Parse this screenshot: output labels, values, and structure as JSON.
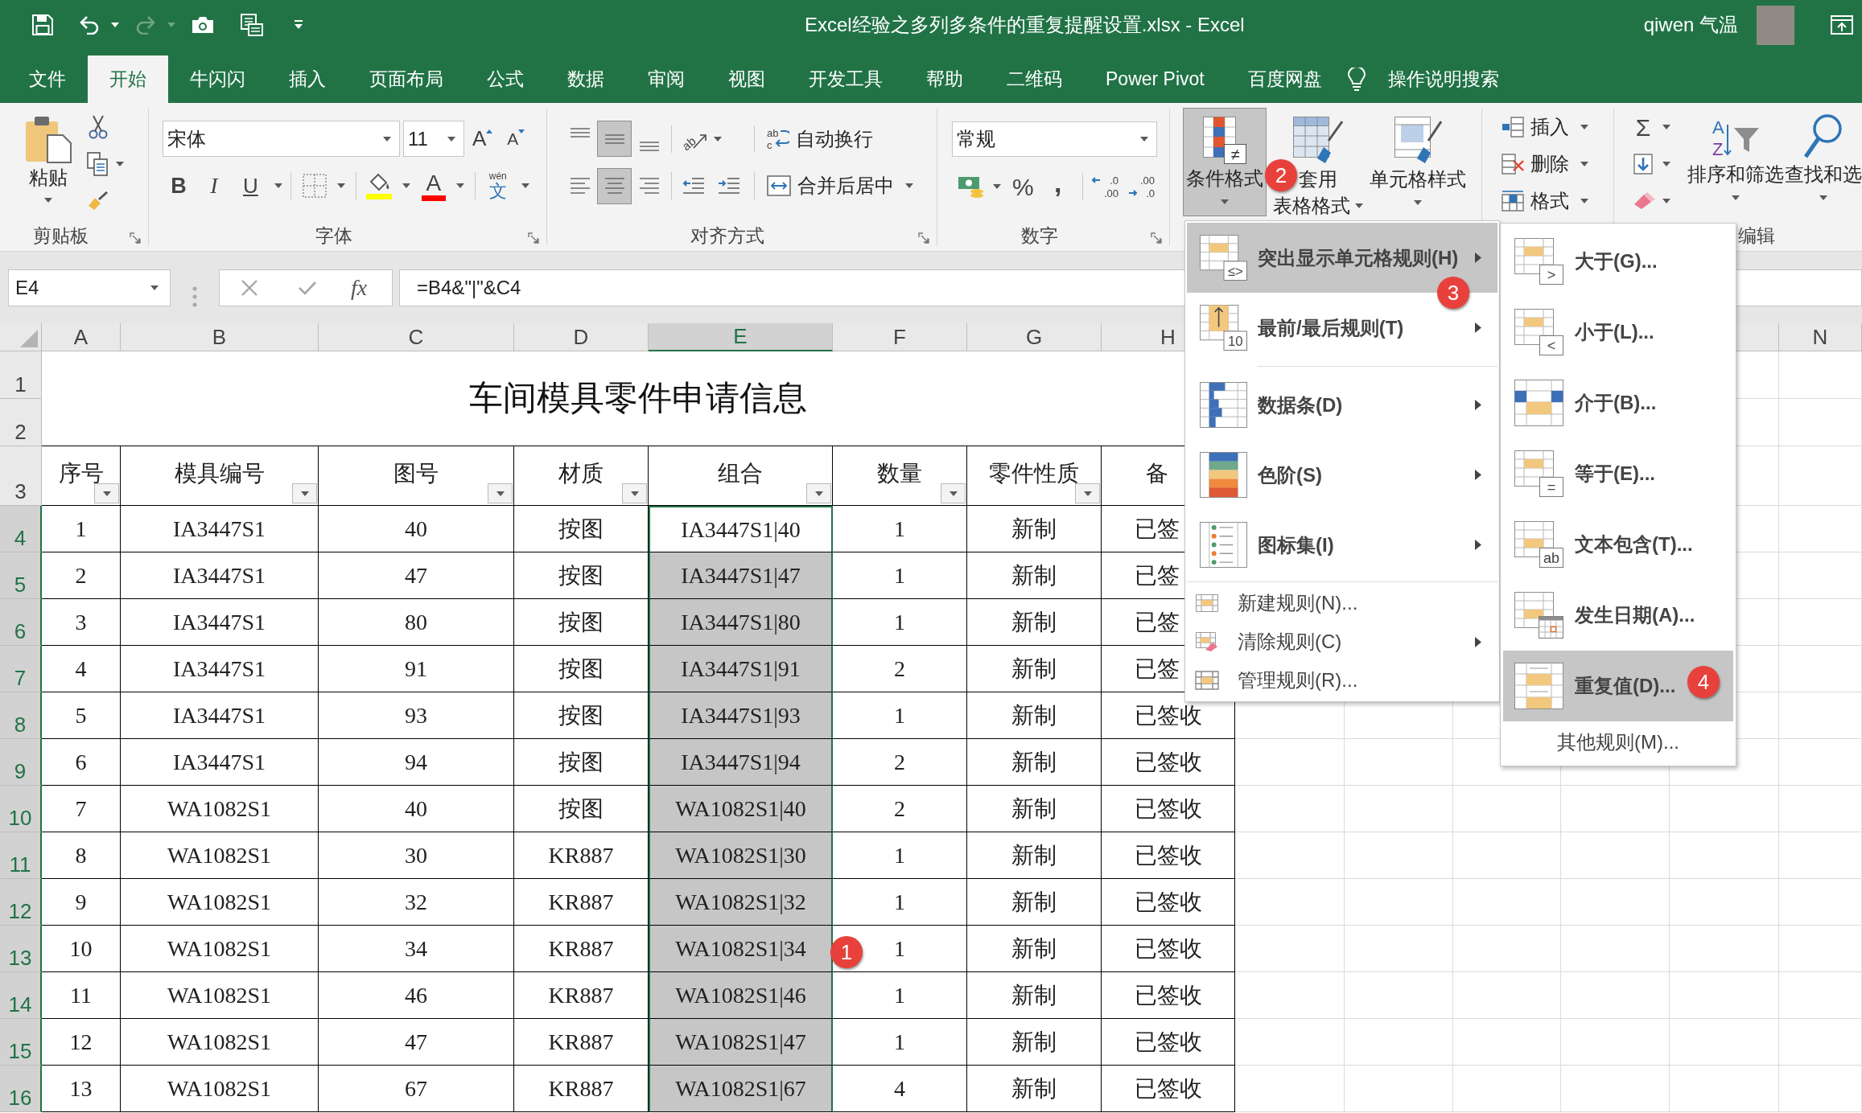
{
  "title_bar": {
    "title": "Excel经验之多列多条件的重复提醒设置.xlsx - Excel",
    "user": "qiwen 气温"
  },
  "quick_access": {
    "redo_disabled": true
  },
  "tabs": [
    {
      "label": "文件",
      "selected": false
    },
    {
      "label": "开始",
      "selected": true
    },
    {
      "label": "牛闪闪",
      "selected": false
    },
    {
      "label": "插入",
      "selected": false
    },
    {
      "label": "页面布局",
      "selected": false
    },
    {
      "label": "公式",
      "selected": false
    },
    {
      "label": "数据",
      "selected": false
    },
    {
      "label": "审阅",
      "selected": false
    },
    {
      "label": "视图",
      "selected": false
    },
    {
      "label": "开发工具",
      "selected": false
    },
    {
      "label": "帮助",
      "selected": false
    },
    {
      "label": "二维码",
      "selected": false
    },
    {
      "label": "Power Pivot",
      "selected": false
    },
    {
      "label": "百度网盘",
      "selected": false
    }
  ],
  "tell_me": "操作说明搜索",
  "clipboard": {
    "label": "剪贴板",
    "paste": "粘贴"
  },
  "font": {
    "label": "字体",
    "font_name": "宋体",
    "font_size": "11",
    "grow_font": "A",
    "shrink_font": "A",
    "bold": "B",
    "italic": "I",
    "underline": "U",
    "font_color": "A",
    "phonetic_guide": "wén",
    "phonetic_char": "文"
  },
  "alignment": {
    "label": "对齐方式",
    "vertical": [
      {
        "kind": "top",
        "selected": false
      },
      {
        "kind": "middle",
        "selected": true
      },
      {
        "kind": "bottom",
        "selected": false
      }
    ],
    "horizontal": [
      {
        "kind": "left",
        "selected": false
      },
      {
        "kind": "center",
        "selected": true
      },
      {
        "kind": "right",
        "selected": false
      }
    ],
    "orientation_glyph": "ab",
    "wrap_glyph": [
      "ab",
      "c"
    ],
    "wrap_text": "自动换行",
    "merge_center": "合并后居中"
  },
  "number": {
    "label": "数字",
    "format": "常规",
    "percent": "%",
    "comma": ",",
    "increase_decimal": [
      ".0",
      ".00"
    ],
    "decrease_decimal": [
      ".00",
      ".0"
    ]
  },
  "styles": {
    "conditional_formatting": {
      "label": "条件格式",
      "icon_text": "≠",
      "selected": true,
      "callout": "2"
    },
    "format_as_table": [
      "套用",
      "表格格式"
    ],
    "cell_styles": "单元格样式"
  },
  "cells": {
    "insert": "插入",
    "delete": "删除",
    "format": "格式"
  },
  "editing": {
    "label": "编辑",
    "autosum": "Σ",
    "sort_glyph": [
      "A",
      "Z"
    ],
    "sort_filter": "排序和筛选",
    "find_select": "查找和选"
  },
  "formula_bar": {
    "name_box": "E4",
    "fx": "fx",
    "formula": "=B4&\"|\"&C4"
  },
  "sheet": {
    "columns": [
      {
        "label": "A",
        "selected": false
      },
      {
        "label": "B",
        "selected": false
      },
      {
        "label": "C",
        "selected": false
      },
      {
        "label": "D",
        "selected": false
      },
      {
        "label": "E",
        "selected": true
      },
      {
        "label": "F",
        "selected": false
      },
      {
        "label": "G",
        "selected": false
      },
      {
        "label": "H",
        "selected": false
      },
      {
        "label": "N",
        "selected": false
      }
    ],
    "row_headers": [
      {
        "label": "1",
        "selected": false
      },
      {
        "label": "2",
        "selected": false
      },
      {
        "label": "3",
        "selected": false
      },
      {
        "label": "4",
        "selected": true
      },
      {
        "label": "5",
        "selected": true
      },
      {
        "label": "6",
        "selected": true
      },
      {
        "label": "7",
        "selected": true
      },
      {
        "label": "8",
        "selected": true
      },
      {
        "label": "9",
        "selected": true
      },
      {
        "label": "10",
        "selected": true
      },
      {
        "label": "11",
        "selected": true
      },
      {
        "label": "12",
        "selected": true
      },
      {
        "label": "13",
        "selected": true
      },
      {
        "label": "14",
        "selected": true
      },
      {
        "label": "15",
        "selected": true
      },
      {
        "label": "16",
        "selected": true
      }
    ],
    "title": "车间模具零件申请信息",
    "header_cells": [
      "序号",
      "模具编号",
      "图号",
      "材质",
      "组合",
      "数量",
      "零件性质",
      "备"
    ],
    "rows": [
      {
        "active": true,
        "cells": [
          "1",
          "IA3447S1",
          "40",
          "按图",
          "IA3447S1|40",
          "1",
          "新制",
          "已签"
        ]
      },
      {
        "active": false,
        "cells": [
          "2",
          "IA3447S1",
          "47",
          "按图",
          "IA3447S1|47",
          "1",
          "新制",
          "已签"
        ]
      },
      {
        "active": false,
        "cells": [
          "3",
          "IA3447S1",
          "80",
          "按图",
          "IA3447S1|80",
          "1",
          "新制",
          "已签"
        ]
      },
      {
        "active": false,
        "cells": [
          "4",
          "IA3447S1",
          "91",
          "按图",
          "IA3447S1|91",
          "2",
          "新制",
          "已签"
        ]
      },
      {
        "active": false,
        "cells": [
          "5",
          "IA3447S1",
          "93",
          "按图",
          "IA3447S1|93",
          "1",
          "新制",
          "已签收"
        ]
      },
      {
        "active": false,
        "cells": [
          "6",
          "IA3447S1",
          "94",
          "按图",
          "IA3447S1|94",
          "2",
          "新制",
          "已签收"
        ]
      },
      {
        "active": false,
        "cells": [
          "7",
          "WA1082S1",
          "40",
          "按图",
          "WA1082S1|40",
          "2",
          "新制",
          "已签收"
        ]
      },
      {
        "active": false,
        "cells": [
          "8",
          "WA1082S1",
          "30",
          "KR887",
          "WA1082S1|30",
          "1",
          "新制",
          "已签收"
        ]
      },
      {
        "active": false,
        "cells": [
          "9",
          "WA1082S1",
          "32",
          "KR887",
          "WA1082S1|32",
          "1",
          "新制",
          "已签收"
        ]
      },
      {
        "active": false,
        "callout": "1",
        "cells": [
          "10",
          "WA1082S1",
          "34",
          "KR887",
          "WA1082S1|34",
          "1",
          "新制",
          "已签收"
        ]
      },
      {
        "active": false,
        "cells": [
          "11",
          "WA1082S1",
          "46",
          "KR887",
          "WA1082S1|46",
          "1",
          "新制",
          "已签收"
        ]
      },
      {
        "active": false,
        "cells": [
          "12",
          "WA1082S1",
          "47",
          "KR887",
          "WA1082S1|47",
          "1",
          "新制",
          "已签收"
        ]
      },
      {
        "active": false,
        "cells": [
          "13",
          "WA1082S1",
          "67",
          "KR887",
          "WA1082S1|67",
          "4",
          "新制",
          "已签收"
        ]
      }
    ]
  },
  "conditional_menu": {
    "items": [
      {
        "kind": "large",
        "label": "突出显示单元格规则(H)",
        "icon_text": "≤>",
        "selected": true,
        "submenu": true,
        "callout": "3"
      },
      {
        "kind": "large",
        "label": "最前/最后规则(T)",
        "icon_text": "10",
        "selected": false,
        "submenu": true
      },
      {
        "kind": "large",
        "label": "数据条(D)",
        "selected": false,
        "submenu": true
      },
      {
        "kind": "large",
        "label": "色阶(S)",
        "selected": false,
        "submenu": true
      },
      {
        "kind": "large",
        "label": "图标集(I)",
        "selected": false,
        "submenu": true
      },
      {
        "kind": "small",
        "label": "新建规则(N)...",
        "selected": false,
        "submenu": false
      },
      {
        "kind": "small",
        "label": "清除规则(C)",
        "selected": false,
        "submenu": true
      },
      {
        "kind": "small",
        "label": "管理规则(R)...",
        "selected": false,
        "submenu": false
      }
    ]
  },
  "highlight_submenu": {
    "items": [
      {
        "kind": "large",
        "label": "大于(G)...",
        "icon_text": ">",
        "selected": false
      },
      {
        "kind": "large",
        "label": "小于(L)...",
        "icon_text": "<",
        "selected": false
      },
      {
        "kind": "large",
        "label": "介于(B)...",
        "selected": false
      },
      {
        "kind": "large",
        "label": "等于(E)...",
        "icon_text": "=",
        "selected": false
      },
      {
        "kind": "large",
        "label": "文本包含(T)...",
        "icon_text": "ab",
        "selected": false
      },
      {
        "kind": "large",
        "label": "发生日期(A)...",
        "selected": false
      },
      {
        "kind": "large",
        "label": "重复值(D)...",
        "selected": true,
        "callout": "4"
      },
      {
        "kind": "plain",
        "label": "其他规则(M)...",
        "selected": false
      }
    ]
  }
}
